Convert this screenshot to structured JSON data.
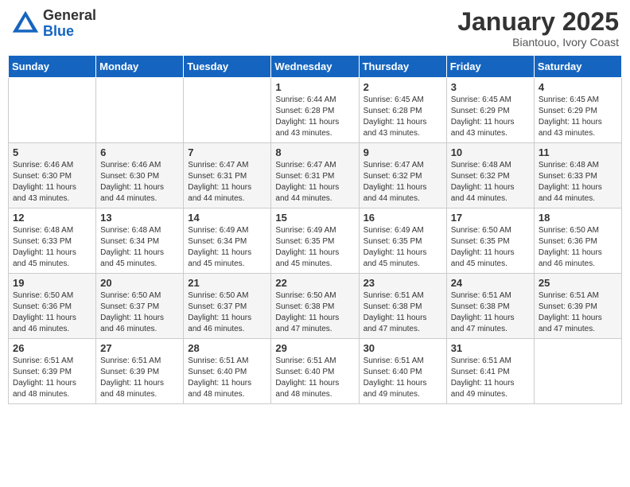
{
  "header": {
    "logo_general": "General",
    "logo_blue": "Blue",
    "month_title": "January 2025",
    "subtitle": "Biantouo, Ivory Coast"
  },
  "days_of_week": [
    "Sunday",
    "Monday",
    "Tuesday",
    "Wednesday",
    "Thursday",
    "Friday",
    "Saturday"
  ],
  "weeks": [
    [
      {
        "day": null,
        "info": null
      },
      {
        "day": null,
        "info": null
      },
      {
        "day": null,
        "info": null
      },
      {
        "day": "1",
        "info": "Sunrise: 6:44 AM\nSunset: 6:28 PM\nDaylight: 11 hours and 43 minutes."
      },
      {
        "day": "2",
        "info": "Sunrise: 6:45 AM\nSunset: 6:28 PM\nDaylight: 11 hours and 43 minutes."
      },
      {
        "day": "3",
        "info": "Sunrise: 6:45 AM\nSunset: 6:29 PM\nDaylight: 11 hours and 43 minutes."
      },
      {
        "day": "4",
        "info": "Sunrise: 6:45 AM\nSunset: 6:29 PM\nDaylight: 11 hours and 43 minutes."
      }
    ],
    [
      {
        "day": "5",
        "info": "Sunrise: 6:46 AM\nSunset: 6:30 PM\nDaylight: 11 hours and 43 minutes."
      },
      {
        "day": "6",
        "info": "Sunrise: 6:46 AM\nSunset: 6:30 PM\nDaylight: 11 hours and 44 minutes."
      },
      {
        "day": "7",
        "info": "Sunrise: 6:47 AM\nSunset: 6:31 PM\nDaylight: 11 hours and 44 minutes."
      },
      {
        "day": "8",
        "info": "Sunrise: 6:47 AM\nSunset: 6:31 PM\nDaylight: 11 hours and 44 minutes."
      },
      {
        "day": "9",
        "info": "Sunrise: 6:47 AM\nSunset: 6:32 PM\nDaylight: 11 hours and 44 minutes."
      },
      {
        "day": "10",
        "info": "Sunrise: 6:48 AM\nSunset: 6:32 PM\nDaylight: 11 hours and 44 minutes."
      },
      {
        "day": "11",
        "info": "Sunrise: 6:48 AM\nSunset: 6:33 PM\nDaylight: 11 hours and 44 minutes."
      }
    ],
    [
      {
        "day": "12",
        "info": "Sunrise: 6:48 AM\nSunset: 6:33 PM\nDaylight: 11 hours and 45 minutes."
      },
      {
        "day": "13",
        "info": "Sunrise: 6:48 AM\nSunset: 6:34 PM\nDaylight: 11 hours and 45 minutes."
      },
      {
        "day": "14",
        "info": "Sunrise: 6:49 AM\nSunset: 6:34 PM\nDaylight: 11 hours and 45 minutes."
      },
      {
        "day": "15",
        "info": "Sunrise: 6:49 AM\nSunset: 6:35 PM\nDaylight: 11 hours and 45 minutes."
      },
      {
        "day": "16",
        "info": "Sunrise: 6:49 AM\nSunset: 6:35 PM\nDaylight: 11 hours and 45 minutes."
      },
      {
        "day": "17",
        "info": "Sunrise: 6:50 AM\nSunset: 6:35 PM\nDaylight: 11 hours and 45 minutes."
      },
      {
        "day": "18",
        "info": "Sunrise: 6:50 AM\nSunset: 6:36 PM\nDaylight: 11 hours and 46 minutes."
      }
    ],
    [
      {
        "day": "19",
        "info": "Sunrise: 6:50 AM\nSunset: 6:36 PM\nDaylight: 11 hours and 46 minutes."
      },
      {
        "day": "20",
        "info": "Sunrise: 6:50 AM\nSunset: 6:37 PM\nDaylight: 11 hours and 46 minutes."
      },
      {
        "day": "21",
        "info": "Sunrise: 6:50 AM\nSunset: 6:37 PM\nDaylight: 11 hours and 46 minutes."
      },
      {
        "day": "22",
        "info": "Sunrise: 6:50 AM\nSunset: 6:38 PM\nDaylight: 11 hours and 47 minutes."
      },
      {
        "day": "23",
        "info": "Sunrise: 6:51 AM\nSunset: 6:38 PM\nDaylight: 11 hours and 47 minutes."
      },
      {
        "day": "24",
        "info": "Sunrise: 6:51 AM\nSunset: 6:38 PM\nDaylight: 11 hours and 47 minutes."
      },
      {
        "day": "25",
        "info": "Sunrise: 6:51 AM\nSunset: 6:39 PM\nDaylight: 11 hours and 47 minutes."
      }
    ],
    [
      {
        "day": "26",
        "info": "Sunrise: 6:51 AM\nSunset: 6:39 PM\nDaylight: 11 hours and 48 minutes."
      },
      {
        "day": "27",
        "info": "Sunrise: 6:51 AM\nSunset: 6:39 PM\nDaylight: 11 hours and 48 minutes."
      },
      {
        "day": "28",
        "info": "Sunrise: 6:51 AM\nSunset: 6:40 PM\nDaylight: 11 hours and 48 minutes."
      },
      {
        "day": "29",
        "info": "Sunrise: 6:51 AM\nSunset: 6:40 PM\nDaylight: 11 hours and 48 minutes."
      },
      {
        "day": "30",
        "info": "Sunrise: 6:51 AM\nSunset: 6:40 PM\nDaylight: 11 hours and 49 minutes."
      },
      {
        "day": "31",
        "info": "Sunrise: 6:51 AM\nSunset: 6:41 PM\nDaylight: 11 hours and 49 minutes."
      },
      {
        "day": null,
        "info": null
      }
    ]
  ]
}
